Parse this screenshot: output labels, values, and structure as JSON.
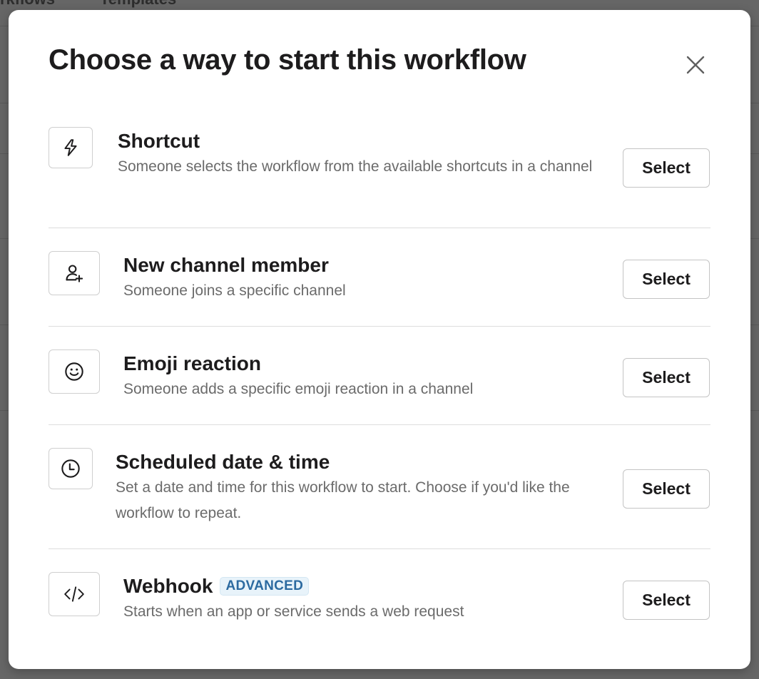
{
  "background": {
    "tabs": [
      "rkflows",
      "Templates"
    ]
  },
  "modal": {
    "title": "Choose a way to start this workflow",
    "close_icon": "close-icon",
    "options": [
      {
        "icon": "lightning-bolt-icon",
        "title": "Shortcut",
        "description": "Someone selects the workflow from the available shortcuts in a channel",
        "button_label": "Select"
      },
      {
        "icon": "user-add-icon",
        "title": "New channel member",
        "description": "Someone joins a specific channel",
        "button_label": "Select"
      },
      {
        "icon": "emoji-smile-icon",
        "title": "Emoji reaction",
        "description": "Someone adds a specific emoji reaction in a channel",
        "button_label": "Select"
      },
      {
        "icon": "clock-icon",
        "title": "Scheduled date & time",
        "description": "Set a date and time for this workflow to start. Choose if you'd like the workflow to repeat.",
        "button_label": "Select"
      },
      {
        "icon": "code-icon",
        "title": "Webhook",
        "badge": "ADVANCED",
        "description": "Starts when an app or service sends a web request",
        "button_label": "Select"
      }
    ]
  },
  "colors": {
    "badge_text": "#2c6aa0",
    "badge_bg": "#e8f3fa",
    "overlay": "#666666"
  }
}
